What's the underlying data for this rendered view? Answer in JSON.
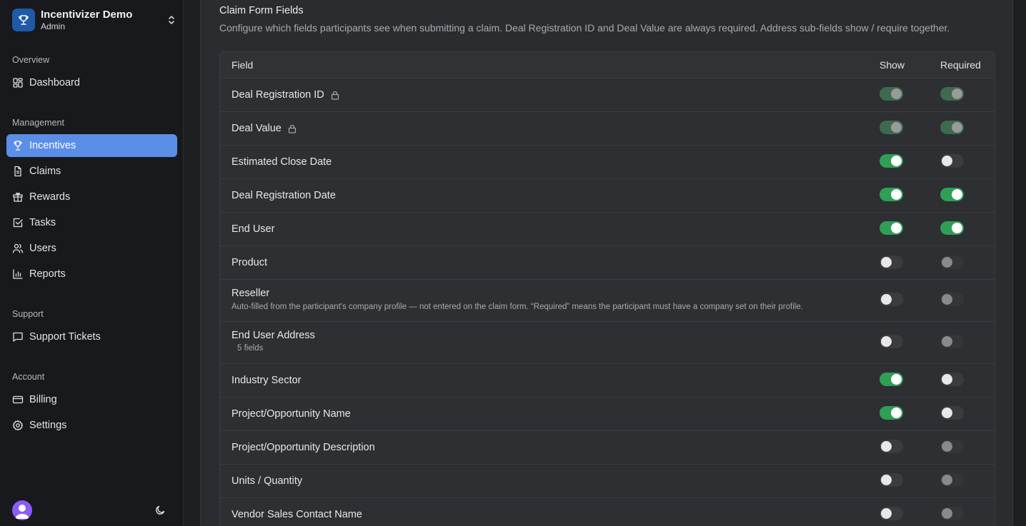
{
  "brand": {
    "name": "Incentivizer Demo",
    "role": "Admin"
  },
  "sidebar": {
    "sections": [
      {
        "label": "Overview",
        "items": [
          {
            "label": "Dashboard",
            "icon": "dashboard-icon"
          }
        ]
      },
      {
        "label": "Management",
        "items": [
          {
            "label": "Incentives",
            "icon": "trophy-icon",
            "active": true
          },
          {
            "label": "Claims",
            "icon": "file-icon"
          },
          {
            "label": "Rewards",
            "icon": "gift-icon"
          },
          {
            "label": "Tasks",
            "icon": "checkbox-icon"
          },
          {
            "label": "Users",
            "icon": "users-icon"
          },
          {
            "label": "Reports",
            "icon": "bar-chart-icon"
          }
        ]
      },
      {
        "label": "Support",
        "items": [
          {
            "label": "Support Tickets",
            "icon": "message-icon"
          }
        ]
      },
      {
        "label": "Account",
        "items": [
          {
            "label": "Billing",
            "icon": "credit-card-icon"
          },
          {
            "label": "Settings",
            "icon": "gear-icon"
          }
        ]
      }
    ],
    "footer": {
      "avatar_icon": "user-avatar-icon",
      "theme_icon": "moon-icon"
    }
  },
  "card": {
    "title": "Claim Form Fields",
    "description": "Configure which fields participants see when submitting a claim. Deal Registration ID and Deal Value are always required. Address sub-fields show / require together."
  },
  "table": {
    "headers": {
      "field": "Field",
      "show": "Show",
      "required": "Required"
    },
    "rows": [
      {
        "label": "Deal Registration ID",
        "locked": true,
        "show": true,
        "required": true
      },
      {
        "label": "Deal Value",
        "locked": true,
        "show": true,
        "required": true
      },
      {
        "label": "Estimated Close Date",
        "show": true,
        "required": false
      },
      {
        "label": "Deal Registration Date",
        "show": true,
        "required": true
      },
      {
        "label": "End User",
        "show": true,
        "required": true
      },
      {
        "label": "Product",
        "show": false,
        "required": false
      },
      {
        "label": "Reseller",
        "sub": "Auto-filled from the participant's company profile — not entered on the claim form. “Required” means the participant must have a company set on their profile.",
        "show": false,
        "required": false
      },
      {
        "label": "End User Address",
        "sub": "5 fields",
        "show": false,
        "required": false
      },
      {
        "label": "Industry Sector",
        "show": true,
        "required": false
      },
      {
        "label": "Project/Opportunity Name",
        "show": true,
        "required": false
      },
      {
        "label": "Project/Opportunity Description",
        "show": false,
        "required": false
      },
      {
        "label": "Units / Quantity",
        "show": false,
        "required": false
      },
      {
        "label": "Vendor Sales Contact Name",
        "show": false,
        "required": false
      }
    ]
  }
}
